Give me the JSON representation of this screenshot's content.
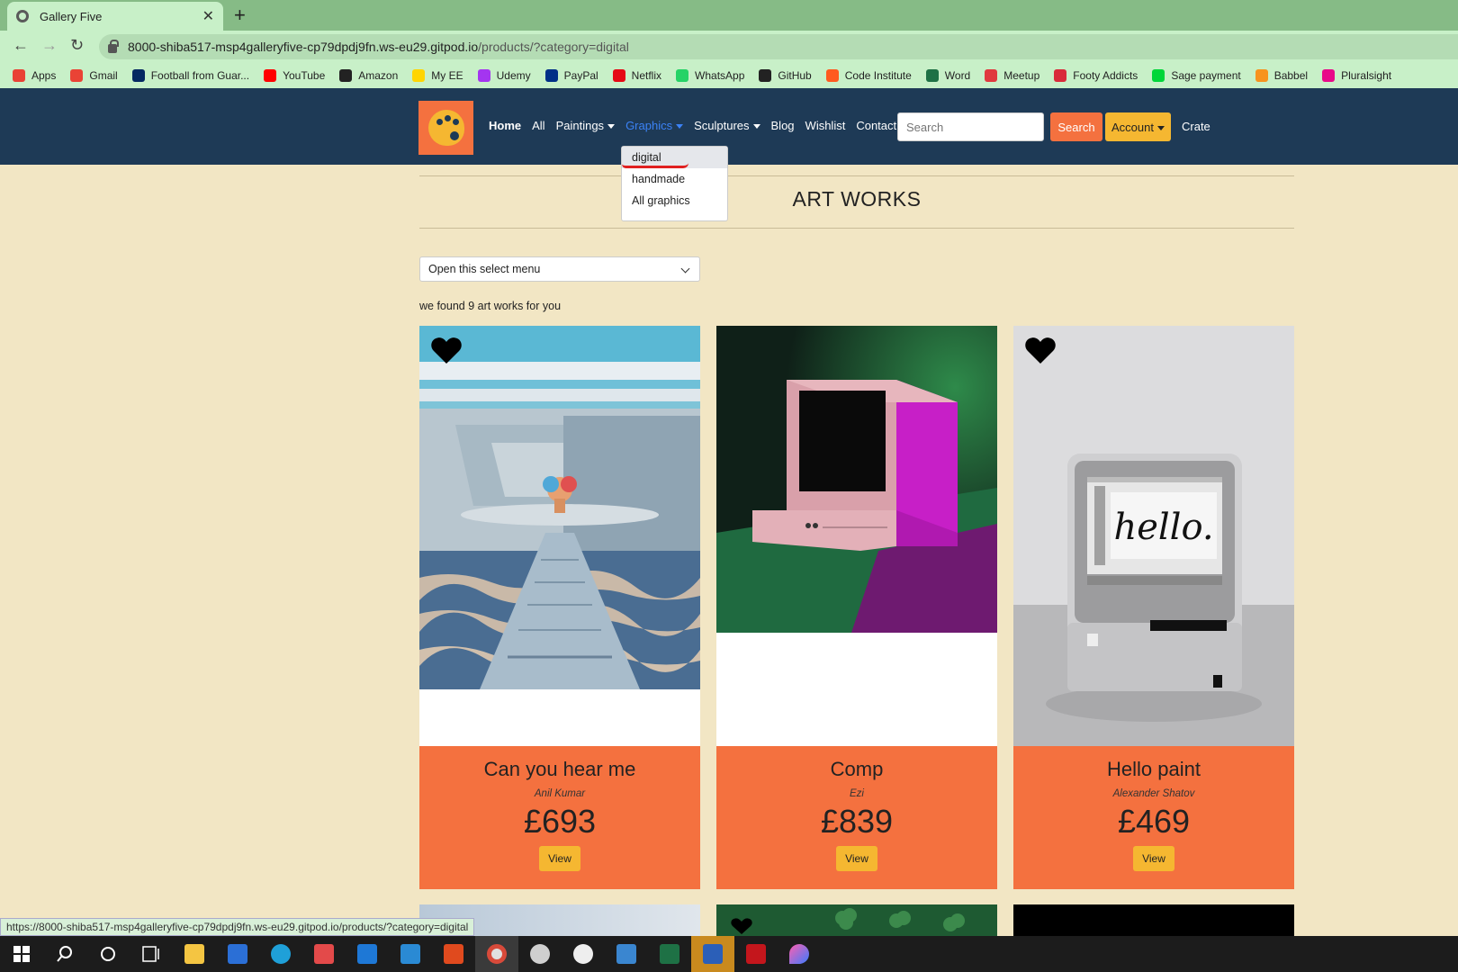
{
  "browser": {
    "tab_title": "Gallery Five",
    "close_glyph": "✕",
    "new_tab_glyph": "+",
    "back_glyph": "←",
    "forward_glyph": "→",
    "reload_glyph": "↻",
    "url_host": "8000-shiba517-msp4galleryfive-cp79dpdj9fn.ws-eu29.gitpod.io",
    "url_path": "/products/?category=digital",
    "status_url": "https://8000-shiba517-msp4galleryfive-cp79dpdj9fn.ws-eu29.gitpod.io/products/?category=digital"
  },
  "bookmarks": [
    {
      "label": "Apps",
      "color": "#e94235"
    },
    {
      "label": "Gmail",
      "color": "#ea4335"
    },
    {
      "label": "Football from Guar...",
      "color": "#052962"
    },
    {
      "label": "YouTube",
      "color": "#ff0000"
    },
    {
      "label": "Amazon",
      "color": "#222222"
    },
    {
      "label": "My EE",
      "color": "#ffd500"
    },
    {
      "label": "Udemy",
      "color": "#a435f0"
    },
    {
      "label": "PayPal",
      "color": "#003087"
    },
    {
      "label": "Netflix",
      "color": "#e50914"
    },
    {
      "label": "WhatsApp",
      "color": "#25d366"
    },
    {
      "label": "GitHub",
      "color": "#222222"
    },
    {
      "label": "Code Institute",
      "color": "#ff5a1f"
    },
    {
      "label": "Word",
      "color": "#1e7145"
    },
    {
      "label": "Meetup",
      "color": "#e0393e"
    },
    {
      "label": "Footy Addicts",
      "color": "#d92b3a"
    },
    {
      "label": "Sage payment",
      "color": "#00d639"
    },
    {
      "label": "Babbel",
      "color": "#f7931e"
    },
    {
      "label": "Pluralsight",
      "color": "#e80a89"
    }
  ],
  "nav": {
    "home": "Home",
    "all": "All",
    "paintings": "Paintings",
    "graphics": "Graphics",
    "sculptures": "Sculptures",
    "blog": "Blog",
    "wishlist": "Wishlist",
    "contact": "Contact",
    "search_placeholder": "Search",
    "search_button": "Search",
    "account": "Account",
    "crate": "Crate"
  },
  "graphics_dropdown": [
    "digital",
    "handmade",
    "All graphics"
  ],
  "main": {
    "title": "ART WORKS",
    "select_label": "Open this select menu",
    "found_text": "we found 9 art works for you"
  },
  "products": [
    {
      "name": "Can you hear me",
      "artist": "Anil Kumar",
      "price": "£693",
      "view": "View",
      "wishlisted": true
    },
    {
      "name": "Comp",
      "artist": "Ezi",
      "price": "£839",
      "view": "View",
      "wishlisted": false
    },
    {
      "name": "Hello paint",
      "artist": "Alexander Shatov",
      "price": "£469",
      "view": "View",
      "wishlisted": true
    }
  ],
  "artwork_text": {
    "screen_word": "hello."
  },
  "colors": {
    "navbar": "#1e3a56",
    "accent_orange": "#f4713f",
    "accent_yellow": "#f5b731",
    "background": "#f2e6c4"
  }
}
